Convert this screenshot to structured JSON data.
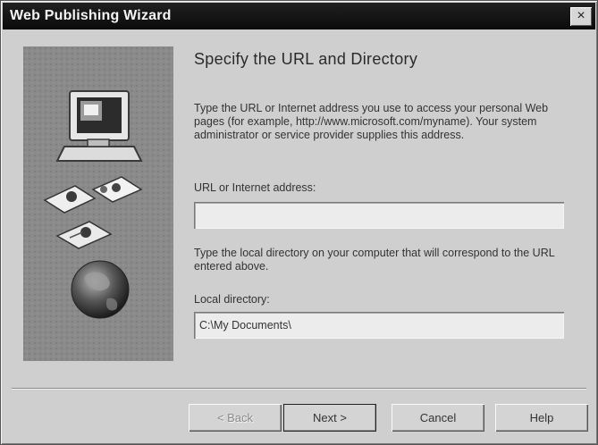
{
  "window": {
    "title": "Web Publishing Wizard",
    "close_glyph": "×"
  },
  "page": {
    "heading": "Specify the URL and Directory",
    "intro": "Type the URL or Internet address you use to access your personal Web pages (for example, http://www.microsoft.com/myname). Your system administrator or service provider supplies this address.",
    "url_label": "URL or Internet address:",
    "url_value": "",
    "local_intro": "Type the local directory on your computer that will correspond to the URL entered above.",
    "local_label": "Local directory:",
    "local_value": "C:\\My Documents\\"
  },
  "buttons": {
    "back": "< Back",
    "next": "Next >",
    "cancel": "Cancel",
    "help": "Help"
  },
  "icons": {
    "side_panel": [
      "computer-icon",
      "document-pages-icon",
      "globe-icon"
    ]
  }
}
